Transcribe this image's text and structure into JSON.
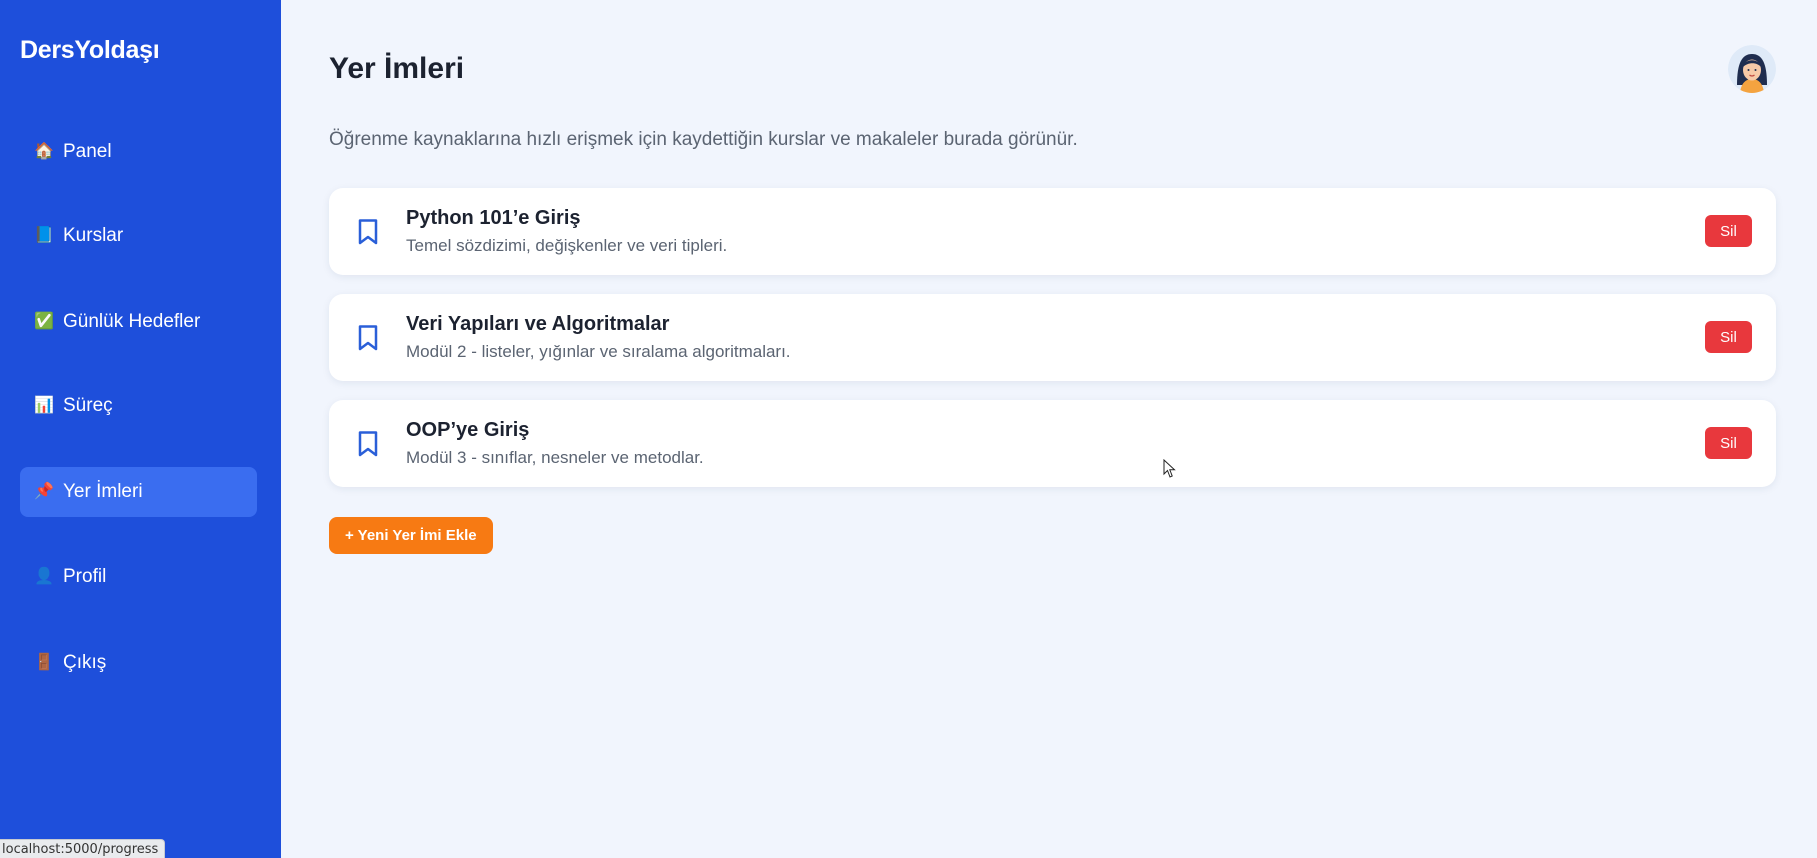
{
  "sidebar": {
    "brand": "DersYoldaşı",
    "items": [
      {
        "label": "Panel",
        "icon": "house-icon",
        "glyph": "🏠"
      },
      {
        "label": "Kurslar",
        "icon": "book-icon",
        "glyph": "📘"
      },
      {
        "label": "Günlük Hedefler",
        "icon": "checkmark-icon",
        "glyph": "✅"
      },
      {
        "label": "Süreç",
        "icon": "bar-chart-icon",
        "glyph": "📊"
      },
      {
        "label": "Yer İmleri",
        "icon": "bookmark-tag-icon",
        "glyph": "📌",
        "active": true
      },
      {
        "label": "Profil",
        "icon": "person-icon",
        "glyph": "👤"
      },
      {
        "label": "Çıkış",
        "icon": "door-icon",
        "glyph": "🚪"
      }
    ]
  },
  "main": {
    "title": "Yer İmleri",
    "subtitle": "Öğrenme kaynaklarına hızlı erişmek için kaydettiğin kurslar ve makaleler burada görünür.",
    "bookmarks": [
      {
        "title": "Python 101’e Giriş",
        "description": "Temel sözdizimi, değişkenler ve veri tipleri.",
        "delete_label": "Sil"
      },
      {
        "title": "Veri Yapıları ve Algoritmalar",
        "description": "Modül 2 - listeler, yığınlar ve sıralama algoritmaları.",
        "delete_label": "Sil"
      },
      {
        "title": "OOP’ye Giriş",
        "description": "Modül 3 - sınıflar, nesneler ve metodlar.",
        "delete_label": "Sil"
      }
    ],
    "add_label": "+ Yeni Yer İmi Ekle"
  },
  "status_bar": {
    "url": "localhost:5000/progress"
  },
  "colors": {
    "sidebar": "#1e4fdb",
    "active_item": "#3a6df0",
    "background": "#f1f5fd",
    "delete": "#e8383d",
    "add": "#f77a13",
    "bookmark_icon": "#2a5fd8"
  }
}
